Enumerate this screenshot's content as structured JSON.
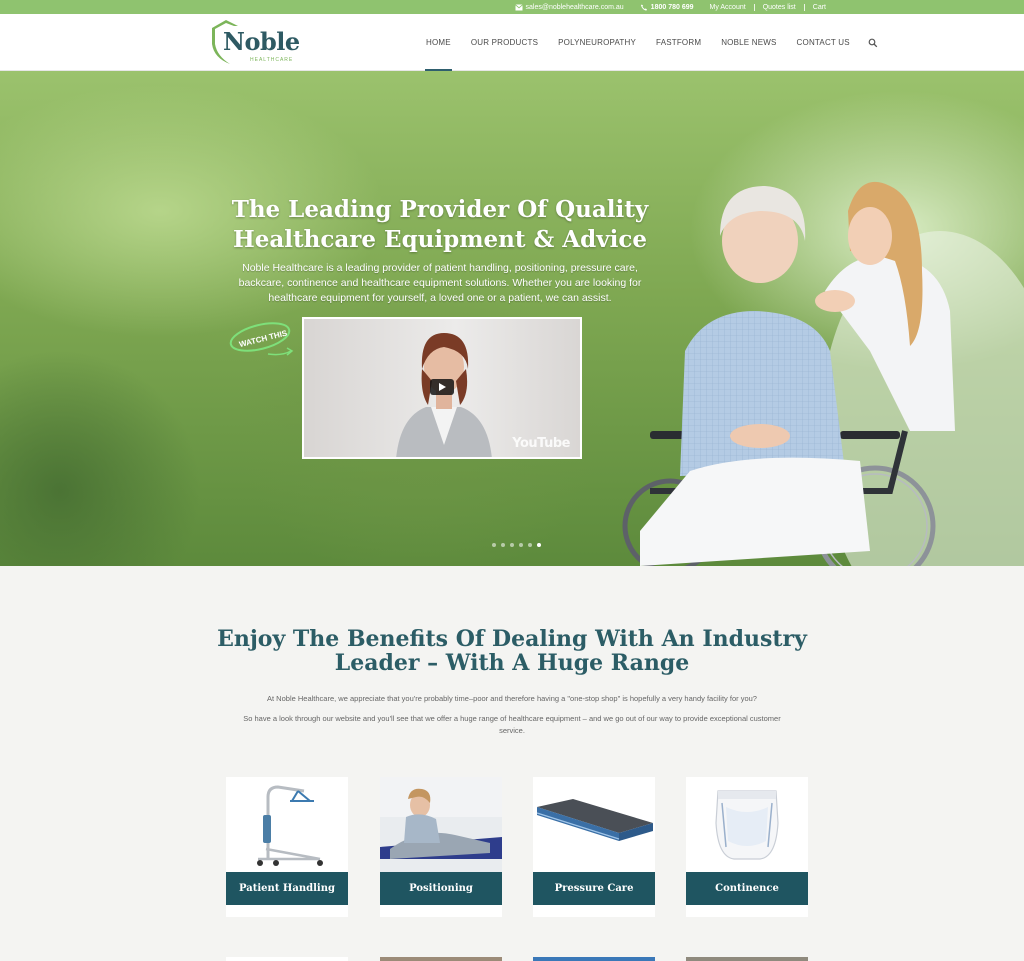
{
  "topbar": {
    "email": "sales@noblehealthcare.com.au",
    "phone": "1800 780 699",
    "my_account": "My Account",
    "quotes": "Quotes list",
    "cart": "Cart"
  },
  "logo": {
    "name": "Noble",
    "tagline": "HEALTHCARE"
  },
  "nav": {
    "items": [
      {
        "label": "HOME",
        "active": true
      },
      {
        "label": "OUR PRODUCTS"
      },
      {
        "label": "POLYNEUROPATHY"
      },
      {
        "label": "FASTFORM"
      },
      {
        "label": "NOBLE NEWS"
      },
      {
        "label": "CONTACT US"
      }
    ]
  },
  "hero": {
    "title_line1": "The Leading Provider Of Quality",
    "title_line2": "Healthcare Equipment & Advice",
    "description": "Noble Healthcare is a leading provider of patient handling, positioning, pressure care, backcare, continence and healthcare equipment solutions. Whether you are looking for healthcare equipment for yourself, a loved one or a patient, we can assist.",
    "watch_label": "WATCH THIS",
    "video_brand": "YouTube",
    "slides_total": 6,
    "slide_active": 6
  },
  "benefits": {
    "title": "Enjoy The Benefits Of Dealing With An Industry Leader – With A Huge Range",
    "p1": "At Noble Healthcare, we appreciate that you're probably time–poor and therefore having a \"one-stop shop\" is hopefully a very handy facility for you?",
    "p2": "So have a look through our website and you'll see that we offer a huge range of healthcare equipment – and we go out of our way to provide exceptional customer service."
  },
  "products": [
    {
      "label": "Patient Handling"
    },
    {
      "label": "Positioning"
    },
    {
      "label": "Pressure Care"
    },
    {
      "label": "Continence"
    }
  ],
  "colors": {
    "topbar": "#8fc36f",
    "brand_dark": "#1f5561",
    "heading": "#2c5d66",
    "accent_green": "#7cb55a"
  }
}
